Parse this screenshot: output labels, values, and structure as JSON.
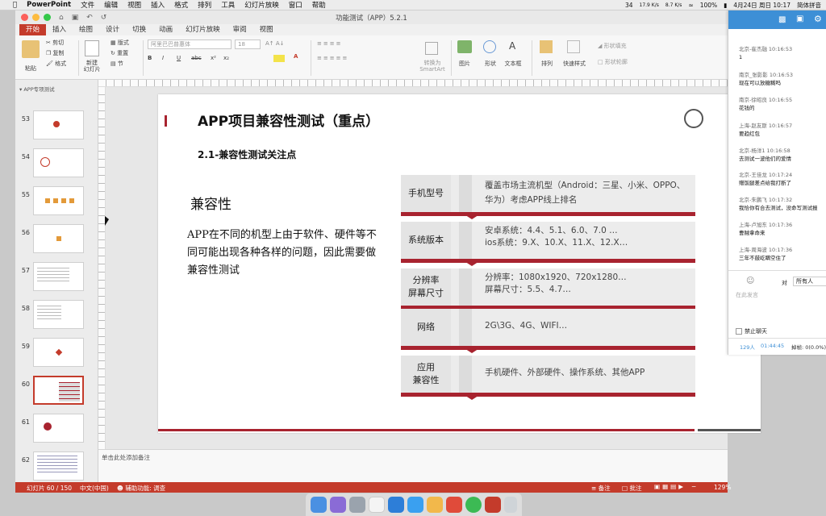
{
  "menubar": {
    "app": "PowerPoint",
    "items": [
      "文件",
      "编辑",
      "视图",
      "插入",
      "格式",
      "排列",
      "工具",
      "幻灯片放映",
      "窗口",
      "帮助"
    ],
    "status": {
      "ime": "简体拼音",
      "battery": "100%",
      "date": "4月24日 周日 10:17",
      "net_up": "17.9 K/s",
      "net_down": "8.7 K/s",
      "count": "34"
    }
  },
  "window": {
    "title": "功能测试（APP）5.2.1"
  },
  "ribbon_tabs": [
    "开始",
    "插入",
    "绘图",
    "设计",
    "切换",
    "动画",
    "幻灯片放映",
    "审阅",
    "视图"
  ],
  "ribbon": {
    "paste": "粘贴",
    "cut": "剪切",
    "copy": "复制",
    "format": "格式",
    "new_slide": "新建\n幻灯片",
    "layout": "版式",
    "reset": "重置",
    "section": "节",
    "font_name": "阿里巴巴普惠体",
    "font_size": "18",
    "convert": "转换为\nSmartArt",
    "picture": "图片",
    "shape": "形状",
    "textbox": "文本框",
    "arrange": "排列",
    "quickstyle": "快速样式",
    "shape_fill": "形状填充",
    "shape_outline": "形状轮廓"
  },
  "thumbs_header": "APP专项测试",
  "thumbnails": [
    {
      "num": "53"
    },
    {
      "num": "54"
    },
    {
      "num": "55"
    },
    {
      "num": "56"
    },
    {
      "num": "57"
    },
    {
      "num": "58"
    },
    {
      "num": "59"
    },
    {
      "num": "60",
      "selected": true
    },
    {
      "num": "61"
    },
    {
      "num": "62"
    }
  ],
  "slide": {
    "title_main": "APP项目兼容性测试",
    "title_paren": "（重点）",
    "subtitle": "2.1-兼容性测试关注点",
    "left_heading": "兼容性",
    "left_body": "APP在不同的机型上由于软件、硬件等不同可能出现各种各样的问题，因此需要做兼容性测试",
    "rows": [
      {
        "label": "手机型号",
        "text": "覆盖市场主流机型（Android：三星、小米、OPPO、华为）考虑APP线上排名"
      },
      {
        "label": "系统版本",
        "text": "安卓系统：4.4、5.1、6.0、7.0 …\nios系统：9.X、10.X、11.X、12.X…"
      },
      {
        "label": "分辨率\n屏幕尺寸",
        "text": "分辨率：1080x1920、720x1280…\n屏幕尺寸：5.5、4.7…"
      },
      {
        "label": "网络",
        "text": "2G\\3G、4G、WIFI…"
      },
      {
        "label": "应用\n兼容性",
        "text": "手机硬件、外部硬件、操作系统、其他APP"
      }
    ]
  },
  "notes_placeholder": "单击此处添加备注",
  "statusbar": {
    "slide_count": "幻灯片 60 / 150",
    "lang": "中文(中国)",
    "accessibility": "辅助功能: 调查",
    "notes": "备注",
    "comments": "批注",
    "zoom": "129%"
  },
  "chat": {
    "messages": [
      {
        "meta": "北京-崔杰融 10:16:53",
        "text": "1"
      },
      {
        "meta": "南京_张影影 10:16:53",
        "text": "现在可以放糖糊吗"
      },
      {
        "meta": "南京-徐昭良 10:16:55",
        "text": "花钱的"
      },
      {
        "meta": "上海-赵友斯 10:16:57",
        "text": "要趋红包"
      },
      {
        "meta": "北京-杨洋1 10:16:58",
        "text": "去测试一波他们的爱情"
      },
      {
        "meta": "北京-王佳龙 10:17:24",
        "text": "赠饭腿差点给我打断了"
      },
      {
        "meta": "北京-朱鹏飞 10:17:32",
        "text": "我恰你有合去测试，没命写测试报"
      },
      {
        "meta": "上海-卢旭东 10:17:36",
        "text": "曹贼拿命来"
      },
      {
        "meta": "上海-周海波 10:17:36",
        "text": "三年不鼓屹瞒空住了"
      }
    ],
    "to_label": "对",
    "to_value": "所有人",
    "input_placeholder": "在此发言",
    "ban": "禁止聊天",
    "online": "129人",
    "duration": "01:44:45",
    "rate": "掉帧: 0(0.0%)"
  },
  "colors": {
    "accent": "#c43b2b",
    "slide_red": "#a8232f",
    "chat_blue": "#3d8fd6"
  }
}
